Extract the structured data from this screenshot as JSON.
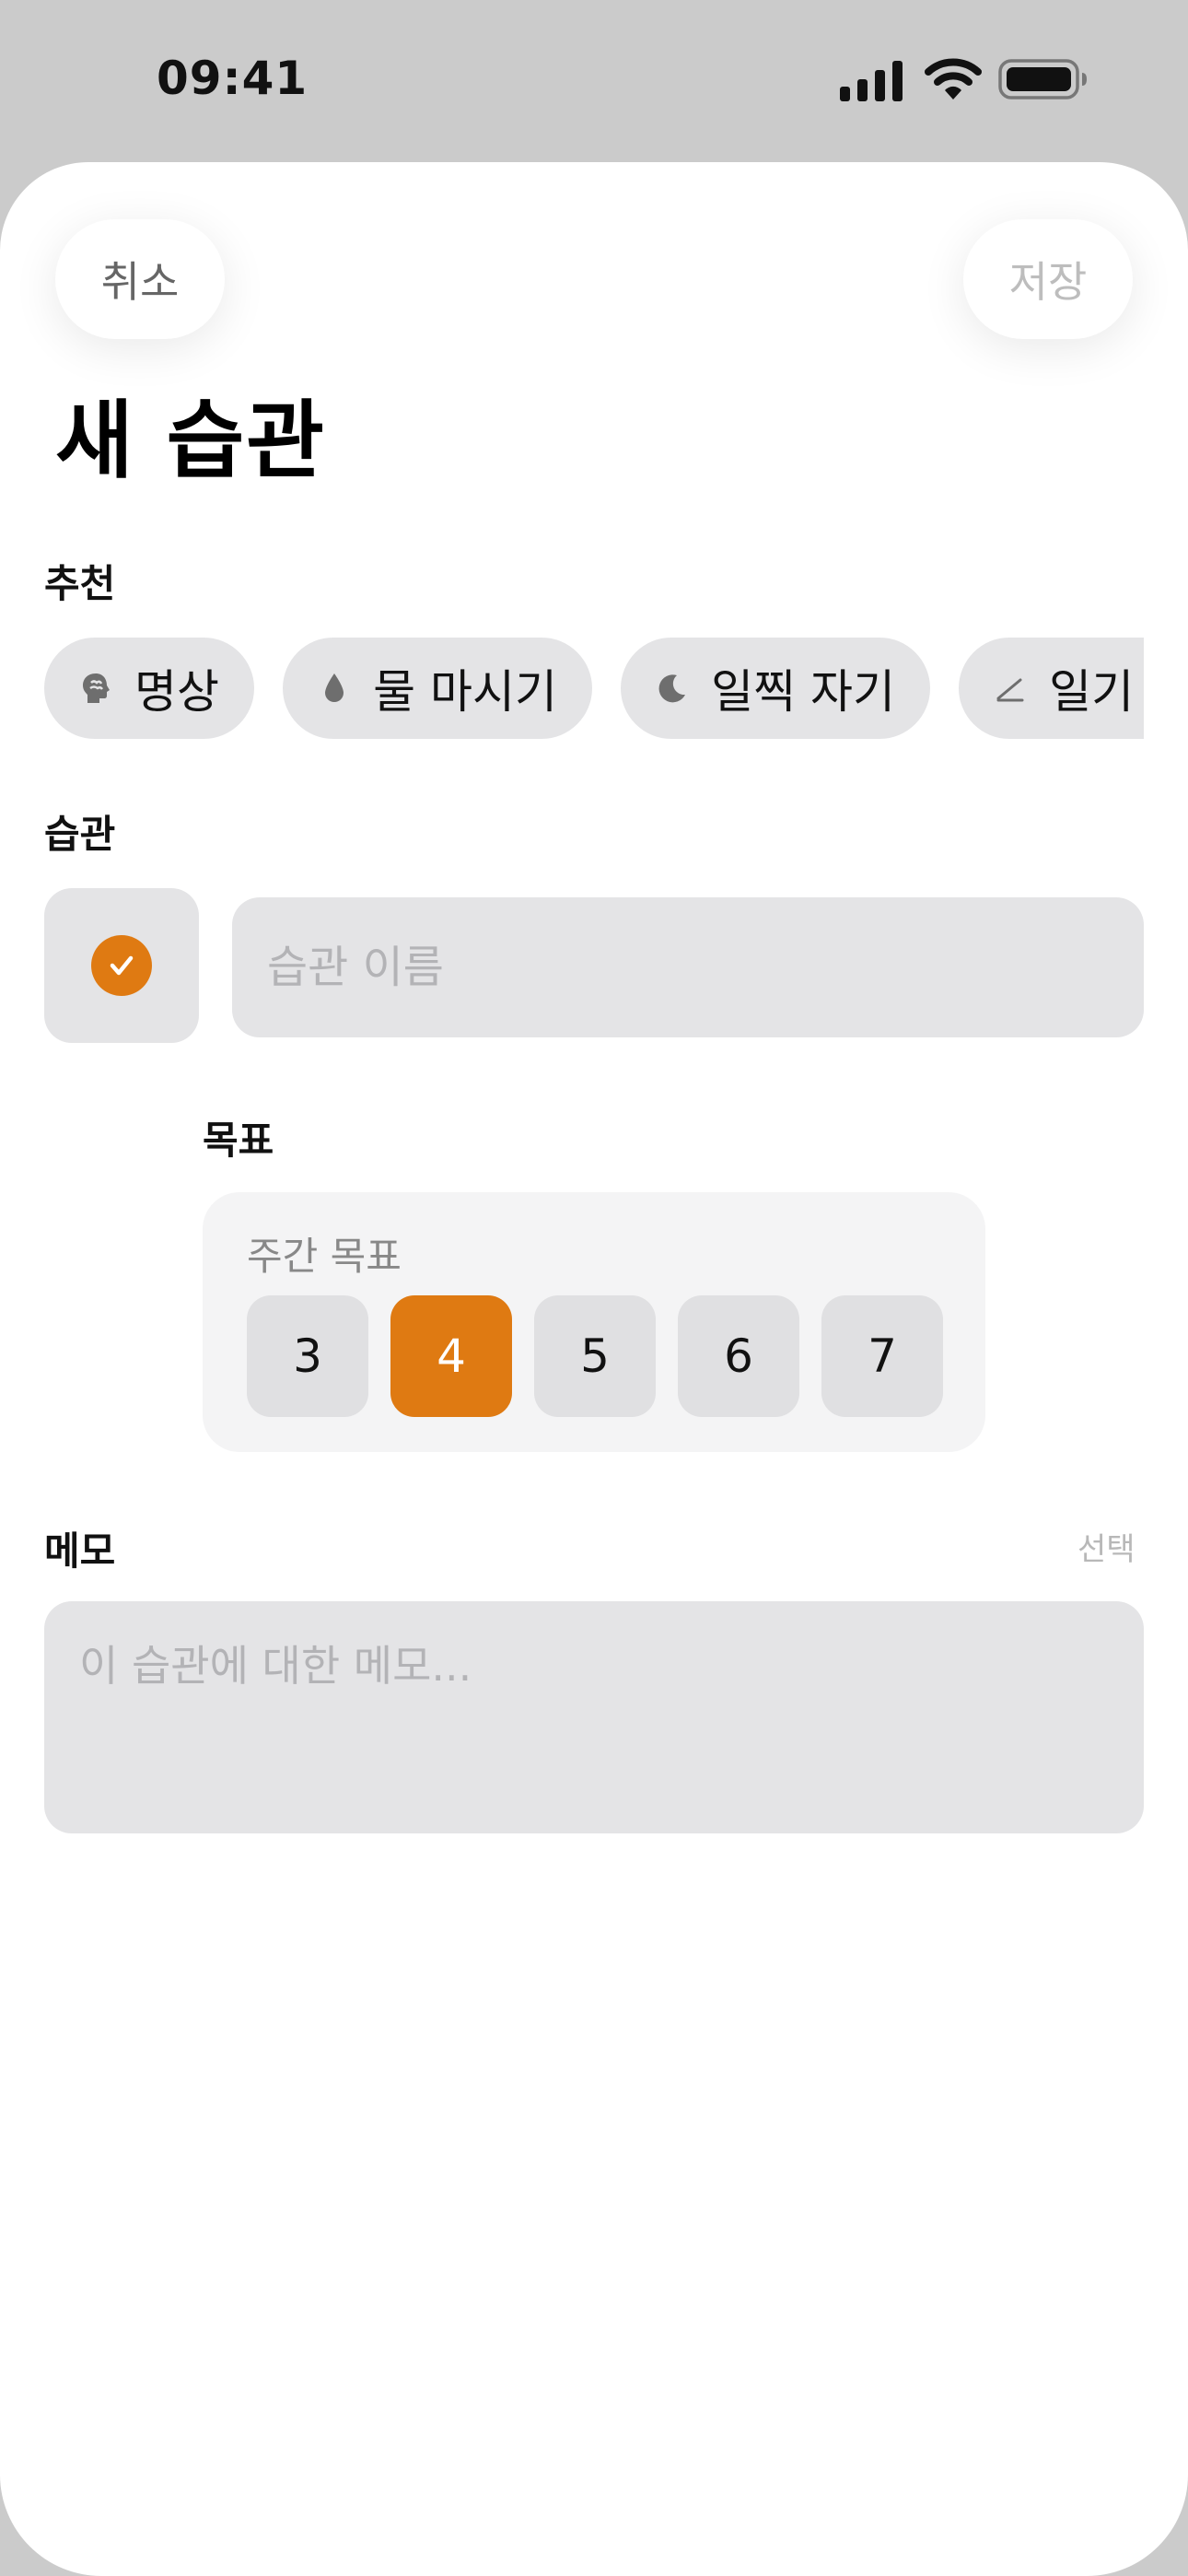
{
  "status_bar": {
    "time": "09:41",
    "icons": [
      "cellular-signal-icon",
      "wifi-icon",
      "battery-icon"
    ]
  },
  "nav": {
    "cancel_label": "취소",
    "save_label": "저장"
  },
  "title": "새 습관",
  "suggestions": {
    "label": "추천",
    "items": [
      {
        "label": "명상",
        "icon": "brain-head-icon"
      },
      {
        "label": "물 마시기",
        "icon": "water-drop-icon"
      },
      {
        "label": "일찍 자기",
        "icon": "moon-icon"
      },
      {
        "label": "일기 쓰기",
        "icon": "pencil-icon"
      }
    ]
  },
  "habit": {
    "label": "습관",
    "icon": "checkmark-circle-icon",
    "name_placeholder": "습관 이름",
    "name_value": ""
  },
  "goal": {
    "label": "목표",
    "subtitle": "주간 목표",
    "options": [
      "3",
      "4",
      "5",
      "6",
      "7"
    ],
    "selected": "4"
  },
  "memo": {
    "label": "메모",
    "optional": "선택",
    "placeholder": "이 습관에 대한 메모...",
    "value": ""
  },
  "colors": {
    "accent": "#df7a12",
    "field_background": "#e4e4e6",
    "backdrop": "#cbcbcb"
  }
}
